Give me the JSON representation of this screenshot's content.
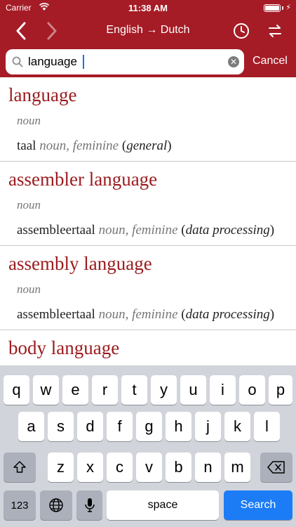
{
  "status": {
    "carrier": "Carrier",
    "time": "11:38 AM"
  },
  "nav": {
    "title": "English → Dutch"
  },
  "search": {
    "query": "language",
    "cancel_label": "Cancel"
  },
  "results": [
    {
      "headword": "language",
      "pos": "noun",
      "translation": "taal",
      "grammar": "noun, feminine",
      "context": "general"
    },
    {
      "headword": "assembler language",
      "pos": "noun",
      "translation": "assembleertaal",
      "grammar": "noun, feminine",
      "context": "data processing"
    },
    {
      "headword": "assembly language",
      "pos": "noun",
      "translation": "assembleertaal",
      "grammar": "noun, feminine",
      "context": "data processing"
    },
    {
      "headword": "body language"
    }
  ],
  "keyboard": {
    "row1": [
      "q",
      "w",
      "e",
      "r",
      "t",
      "y",
      "u",
      "i",
      "o",
      "p"
    ],
    "row2": [
      "a",
      "s",
      "d",
      "f",
      "g",
      "h",
      "j",
      "k",
      "l"
    ],
    "row3": [
      "z",
      "x",
      "c",
      "v",
      "b",
      "n",
      "m"
    ],
    "numbers_label": "123",
    "space_label": "space",
    "search_label": "Search"
  },
  "colors": {
    "accent": "#a51c26",
    "headword": "#9b1b1f",
    "search_key": "#1c7cf6"
  }
}
